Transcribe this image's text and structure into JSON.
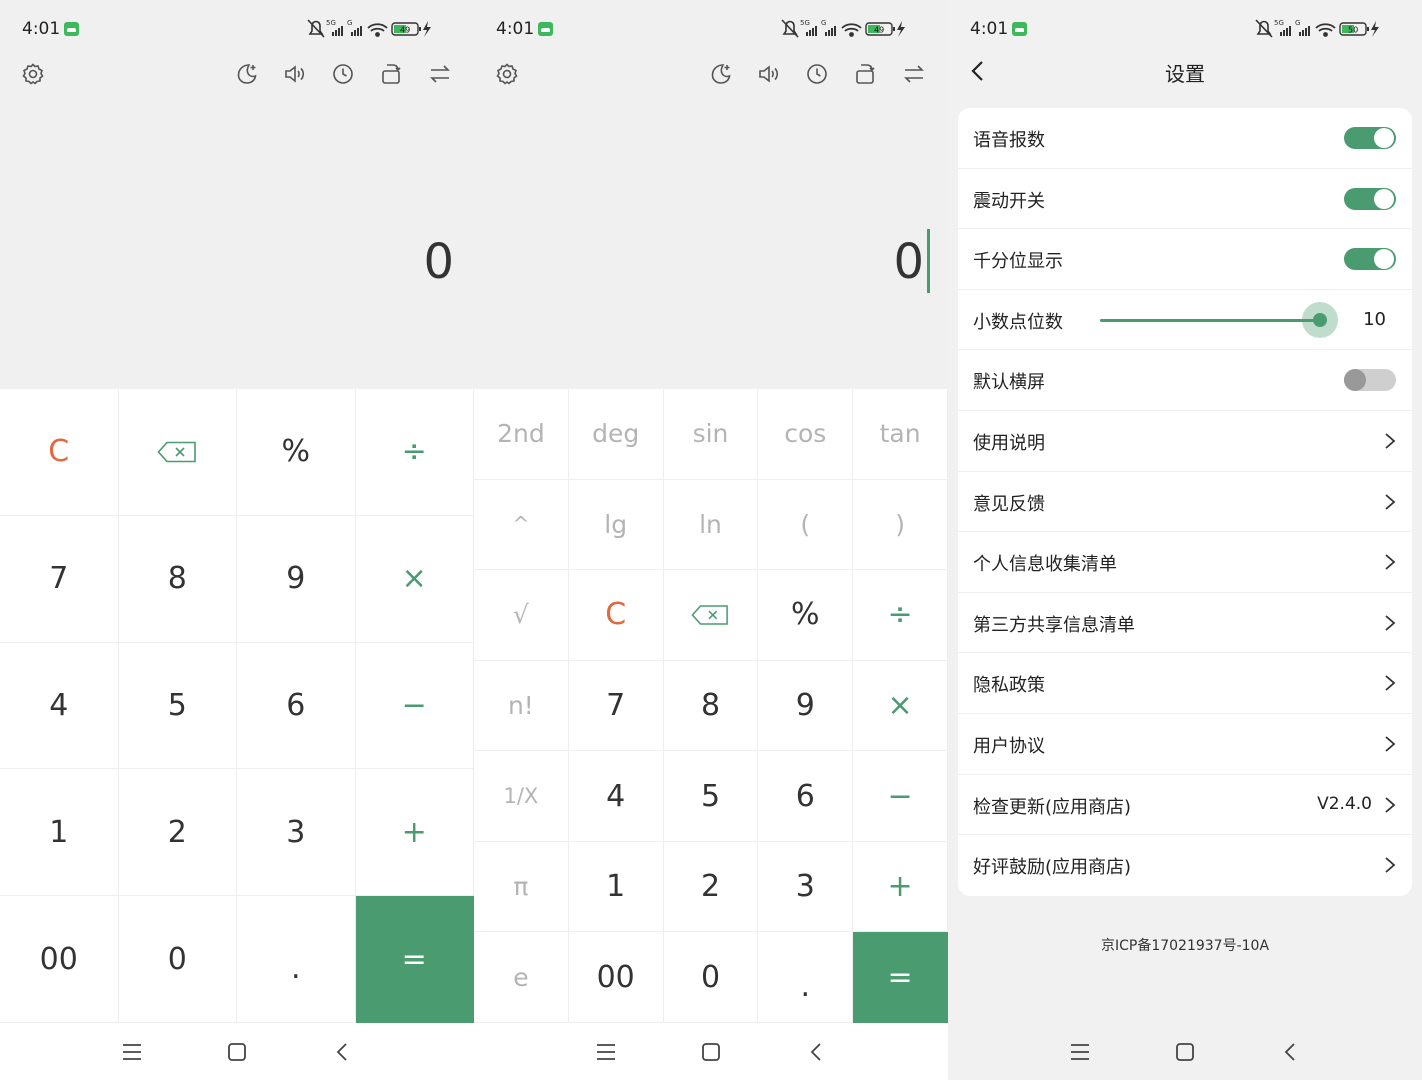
{
  "status_bar": {
    "p1": {
      "time": "4:01",
      "battery": "49"
    },
    "p2": {
      "time": "4:01",
      "battery": "49"
    },
    "p3": {
      "time": "4:01",
      "battery": "50"
    }
  },
  "basic_calc": {
    "display_value": "0",
    "keys": [
      "C",
      "backspace",
      "%",
      "÷",
      "7",
      "8",
      "9",
      "×",
      "4",
      "5",
      "6",
      "−",
      "1",
      "2",
      "3",
      "+",
      "00",
      "0",
      ".",
      "="
    ]
  },
  "sci_calc": {
    "display_value": "0",
    "keys": [
      "2nd",
      "deg",
      "sin",
      "cos",
      "tan",
      "^",
      "lg",
      "ln",
      "(",
      ")",
      "√",
      "C",
      "backspace",
      "%",
      "÷",
      "n!",
      "7",
      "8",
      "9",
      "×",
      "1/X",
      "4",
      "5",
      "6",
      "−",
      "π",
      "1",
      "2",
      "3",
      "+",
      "e",
      "00",
      "0",
      ".",
      "="
    ]
  },
  "settings": {
    "title": "设置",
    "voice_label": "语音报数",
    "voice_on": true,
    "vibrate_label": "震动开关",
    "vibrate_on": true,
    "thousands_label": "千分位显示",
    "thousands_on": true,
    "decimals_label": "小数点位数",
    "decimals_value": "10",
    "landscape_label": "默认横屏",
    "landscape_on": false,
    "manual_label": "使用说明",
    "feedback_label": "意见反馈",
    "personal_info_label": "个人信息收集清单",
    "third_party_label": "第三方共享信息清单",
    "privacy_label": "隐私政策",
    "agreement_label": "用户协议",
    "update_label": "检查更新(应用商店)",
    "version": "V2.4.0",
    "rate_label": "好评鼓励(应用商店)",
    "icp": "京ICP备17021937号-10A"
  },
  "colors": {
    "accent": "#4a9b6f",
    "clear": "#e2683f",
    "background": "#f0f0f0"
  },
  "icons": {
    "toolbar": [
      "settings-gear-icon",
      "theme-moon-icon",
      "sound-icon",
      "history-clock-icon",
      "rotate-screen-icon",
      "convert-arrows-icon"
    ],
    "nav": [
      "menu-icon",
      "home-icon",
      "back-icon"
    ]
  }
}
